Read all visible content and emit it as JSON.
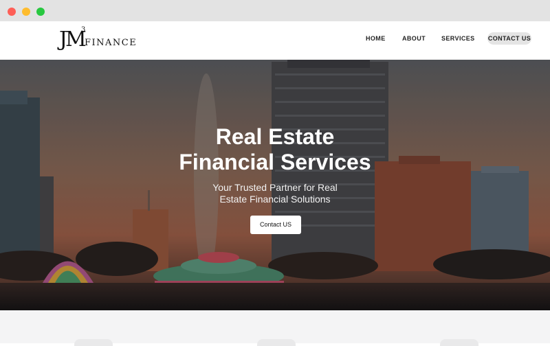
{
  "window": {
    "controls": [
      "close",
      "minimize",
      "maximize"
    ]
  },
  "header": {
    "logo": {
      "letters": "JM",
      "superscript": "3",
      "word": "FINANCE"
    },
    "nav": [
      {
        "label": "HOME"
      },
      {
        "label": "ABOUT"
      },
      {
        "label": "SERVICES"
      },
      {
        "label": "CONTACT US"
      }
    ]
  },
  "hero": {
    "title_line1": "Real Estate",
    "title_line2": "Financial Services",
    "subtitle_line1": "Your Trusted Partner for Real",
    "subtitle_line2": "Estate Financial Solutions",
    "cta_label": "Contact US"
  },
  "colors": {
    "nav_active_bg": "#e4e4e4",
    "hero_text": "#ffffff",
    "section_bg": "#f4f4f5"
  }
}
